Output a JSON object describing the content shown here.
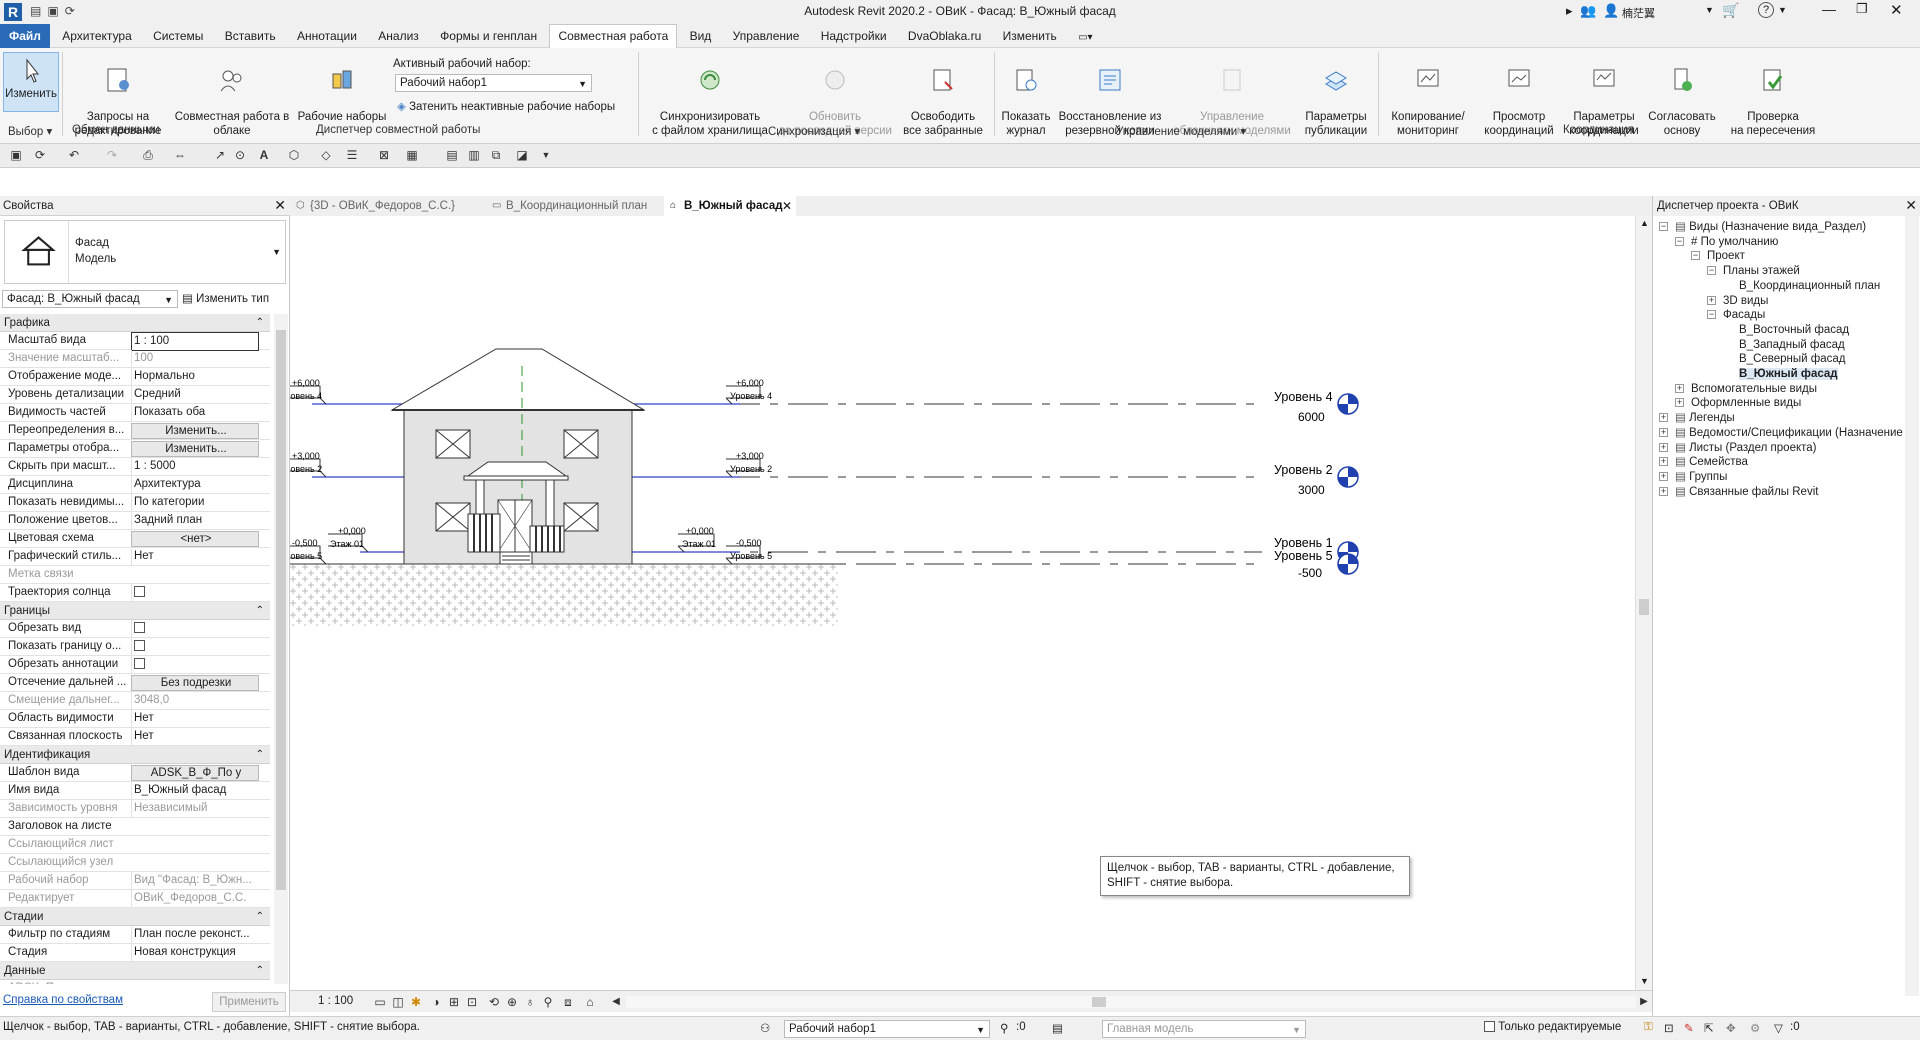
{
  "title": {
    "app": "Autodesk Revit 2020.2 - ОВиК - Фасад: В_Южный фасад",
    "user": "楠茫翼"
  },
  "menu": [
    "Файл",
    "Архитектура",
    "Системы",
    "Вставить",
    "Аннотации",
    "Анализ",
    "Формы и генплан",
    "Совместная работа",
    "Вид",
    "Управление",
    "Надстройки",
    "DvaOblaka.ru",
    "Изменить"
  ],
  "ribbon": {
    "modify": "Изменить",
    "select": "Выбор",
    "exchange_panel": "Обмен данными",
    "edit_requests": "Запросы на\nредактирование",
    "cloud_collab": "Совместная работа в\nоблаке",
    "worksets": "Рабочие наборы",
    "active_workset_label": "Активный рабочий набор:",
    "active_workset": "Рабочий набор1",
    "gray_inactive": "Затенить неактивные рабочие наборы",
    "manage_collab_panel": "Диспетчер совместной работы",
    "sync": "Синхронизировать\nс файлом хранилища",
    "reload_latest": "Обновить\nдо последней версии",
    "relinquish": "Освободить\nвсе забранные",
    "sync_panel": "Синхронизация",
    "show_history": "Показать\nжурнал",
    "restore_backup": "Восстановление из\nрезервной копии",
    "cloud_models": "Управление\nоблачными моделями",
    "publish_settings": "Параметры\nпубликации",
    "manage_models_panel": "Управление моделями",
    "copy_monitor": "Копирование/\nмониторинг",
    "coord_review": "Просмотр\nкоординаций",
    "coord_settings": "Параметры\nкоординации",
    "reconcile": "Согласовать\nоснову",
    "interference": "Проверка\nна пересечения",
    "coord_panel": "Координация"
  },
  "properties": {
    "header": "Свойства",
    "type_line1": "Фасад",
    "type_line2": "Модель",
    "selector": "Фасад: В_Южный фасад",
    "edit_type": "Изменить тип",
    "groups": {
      "graphics": "Графика",
      "extents": "Границы",
      "identity": "Идентификация",
      "phasing": "Стадии",
      "data": "Данные"
    },
    "graphics_rows": [
      {
        "k": "Масштаб вида",
        "v": "1 : 100",
        "mode": "edit"
      },
      {
        "k": "Значение масштаб...",
        "v": "100",
        "mode": "dis"
      },
      {
        "k": "Отображение моде...",
        "v": "Нормально",
        "mode": ""
      },
      {
        "k": "Уровень детализации",
        "v": "Средний",
        "mode": ""
      },
      {
        "k": "Видимость частей",
        "v": "Показать оба",
        "mode": ""
      },
      {
        "k": "Переопределения в...",
        "v": "Изменить...",
        "mode": "btn"
      },
      {
        "k": "Параметры отобра...",
        "v": "Изменить...",
        "mode": "btn"
      },
      {
        "k": "Скрыть при масшт...",
        "v": "1 : 5000",
        "mode": ""
      },
      {
        "k": "Дисциплина",
        "v": "Архитектура",
        "mode": ""
      },
      {
        "k": "Показать невидимы...",
        "v": "По категории",
        "mode": ""
      },
      {
        "k": "Положение цветов...",
        "v": "Задний план",
        "mode": ""
      },
      {
        "k": "Цветовая схема",
        "v": "<нет>",
        "mode": "btn"
      },
      {
        "k": "Графический стиль...",
        "v": "Нет",
        "mode": ""
      },
      {
        "k": "Метка связи",
        "v": "",
        "mode": "dis"
      },
      {
        "k": "Траектория солнца",
        "v": "",
        "mode": "chk"
      }
    ],
    "extents_rows": [
      {
        "k": "Обрезать вид",
        "v": "",
        "mode": "chk"
      },
      {
        "k": "Показать границу о...",
        "v": "",
        "mode": "chk"
      },
      {
        "k": "Обрезать аннотации",
        "v": "",
        "mode": "chk"
      },
      {
        "k": "Отсечение дальней ...",
        "v": "Без подрезки",
        "mode": "btn"
      },
      {
        "k": "Смещение дальнег...",
        "v": "3048,0",
        "mode": "dis"
      },
      {
        "k": "Область видимости",
        "v": "Нет",
        "mode": ""
      },
      {
        "k": "Связанная плоскость",
        "v": "Нет",
        "mode": ""
      }
    ],
    "identity_rows": [
      {
        "k": "Шаблон вида",
        "v": "ADSK_В_Ф_По у",
        "mode": "btn"
      },
      {
        "k": "Имя вида",
        "v": "В_Южный фасад",
        "mode": ""
      },
      {
        "k": "Зависимость уровня",
        "v": "Независимый",
        "mode": "dis"
      },
      {
        "k": "Заголовок на листе",
        "v": "",
        "mode": ""
      },
      {
        "k": "Ссылающийся лист",
        "v": "",
        "mode": "dis"
      },
      {
        "k": "Ссылающийся узел",
        "v": "",
        "mode": "dis"
      },
      {
        "k": "Рабочий набор",
        "v": "Вид \"Фасад: В_Южн...",
        "mode": "dis"
      },
      {
        "k": "Редактирует",
        "v": "ОВиК_Федоров_С.С.",
        "mode": "dis"
      }
    ],
    "phasing_rows": [
      {
        "k": "Фильтр по стадиям",
        "v": "План после реконст...",
        "mode": ""
      },
      {
        "k": "Стадия",
        "v": "Новая конструкция",
        "mode": ""
      }
    ],
    "data_rows": [
      {
        "k": "ADSK_Примечание",
        "v": "",
        "mode": "dis"
      }
    ],
    "help": "Справка по свойствам",
    "apply": "Применить"
  },
  "tabs": [
    "{3D - ОВиК_Федоров_С.С.}",
    "В_Координационный план",
    "В_Южный фасад"
  ],
  "elevation": {
    "levels": [
      {
        "name": "Уровень 4",
        "value": "6000",
        "tag_value": "+6,000",
        "tag_name": "Уровень 4"
      },
      {
        "name": "Уровень 2",
        "value": "3000",
        "tag_value": "+3,000",
        "tag_name": "Уровень 2"
      },
      {
        "name": "Уровень 1",
        "value": "",
        "tag_value": "+0,000",
        "tag_name": "Этаж 01"
      },
      {
        "name": "Уровень 5",
        "value": "-500",
        "tag_value": "-0,500",
        "tag_name": "Уровень 5"
      }
    ],
    "tooltip": "Щелчок - выбор, TAB - варианты, CTRL - добавление,\nSHIFT - снятие выбора."
  },
  "viewbar": {
    "scale": "1 : 100"
  },
  "browser": {
    "header": "Диспетчер проекта - ОВиК",
    "items": [
      {
        "t": "Виды (Назначение вида_Раздел)",
        "l": 0,
        "tog": "-",
        "icon": true
      },
      {
        "t": "# По умолчанию",
        "l": 1,
        "tog": "-"
      },
      {
        "t": "Проект",
        "l": 2,
        "tog": "-"
      },
      {
        "t": "Планы этажей",
        "l": 3,
        "tog": "-"
      },
      {
        "t": "В_Координационный план",
        "l": 4,
        "tog": ""
      },
      {
        "t": "3D виды",
        "l": 3,
        "tog": "+"
      },
      {
        "t": "Фасады",
        "l": 3,
        "tog": "-"
      },
      {
        "t": "В_Восточный фасад",
        "l": 4,
        "tog": ""
      },
      {
        "t": "В_Западный фасад",
        "l": 4,
        "tog": ""
      },
      {
        "t": "В_Северный фасад",
        "l": 4,
        "tog": ""
      },
      {
        "t": "В_Южный фасад",
        "l": 4,
        "tog": "",
        "bold": true
      },
      {
        "t": "Вспомогательные виды",
        "l": 1,
        "tog": "+"
      },
      {
        "t": "Оформленные виды",
        "l": 1,
        "tog": "+"
      },
      {
        "t": "Легенды",
        "l": 0,
        "tog": "+",
        "icon": true
      },
      {
        "t": "Ведомости/Спецификации (Назначение",
        "l": 0,
        "tog": "+",
        "icon": true
      },
      {
        "t": "Листы (Раздел проекта)",
        "l": 0,
        "tog": "+",
        "icon": true
      },
      {
        "t": "Семейства",
        "l": 0,
        "tog": "+",
        "icon": true
      },
      {
        "t": "Группы",
        "l": 0,
        "tog": "+",
        "icon": true
      },
      {
        "t": "Связанные файлы Revit",
        "l": 0,
        "tog": "+",
        "icon": true
      }
    ]
  },
  "status": {
    "hint": "Щелчок - выбор, TAB - варианты, CTRL - добавление, SHIFT - снятие выбора.",
    "workset": "Рабочий набор1",
    "count": ":0",
    "model": "Главная модель",
    "editable_only": "Только редактируемые",
    "filter_count": ":0"
  }
}
